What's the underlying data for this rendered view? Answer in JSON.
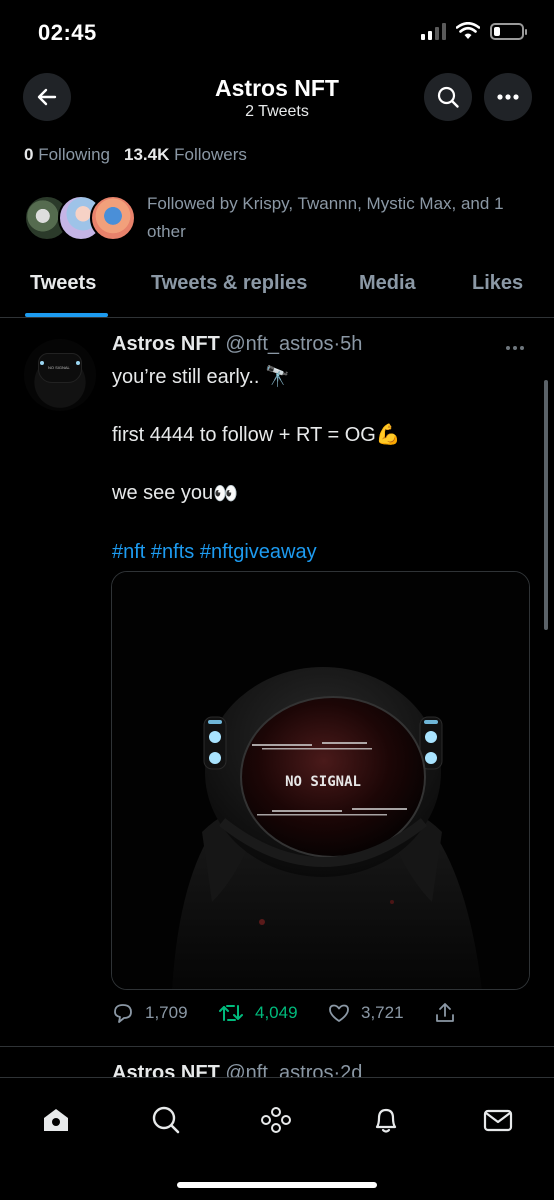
{
  "status_bar": {
    "time": "02:45"
  },
  "header": {
    "title": "Astros NFT",
    "subtitle": "2 Tweets"
  },
  "profile": {
    "following_count": "0",
    "following_label": "Following",
    "followers_count": "13.4K",
    "followers_label": "Followers",
    "followed_by_text": "Followed by Krispy, Twannn, Mystic Max, and 1 other"
  },
  "tabs": [
    {
      "label": "Tweets",
      "active": true
    },
    {
      "label": "Tweets & replies",
      "active": false
    },
    {
      "label": "Media",
      "active": false
    },
    {
      "label": "Likes",
      "active": false
    }
  ],
  "tweet": {
    "author_name": "Astros NFT",
    "author_handle": "@nft_astros",
    "separator": "·",
    "time": "5h",
    "lines": {
      "line1": "you’re still early..",
      "line1_emoji": "🔭",
      "line2": "first 4444 to follow + RT = OG",
      "line2_emoji": "💪",
      "line3": "we see you",
      "line3_emoji": "👀"
    },
    "hashtags": [
      "#nft",
      "#nfts",
      "#nftgiveaway"
    ],
    "media_label": "NO SIGNAL",
    "avatar_label": "NO SIGNAL",
    "replies": "1,709",
    "retweets": "4,049",
    "likes": "3,721"
  },
  "next_tweet": {
    "author_name": "Astros NFT",
    "author_handle": "@nft_astros",
    "separator": "·",
    "time": "2d"
  },
  "colors": {
    "accent": "#1d9bf0",
    "retweet": "#00ba7c",
    "muted": "#8b98a5",
    "background": "#000000"
  },
  "icons": {
    "back": "arrow-left-icon",
    "search": "search-icon",
    "more": "more-horizontal-icon",
    "home": "home-icon",
    "explore": "search-icon",
    "spaces": "spaces-icon",
    "notifications": "bell-icon",
    "messages": "mail-icon"
  }
}
